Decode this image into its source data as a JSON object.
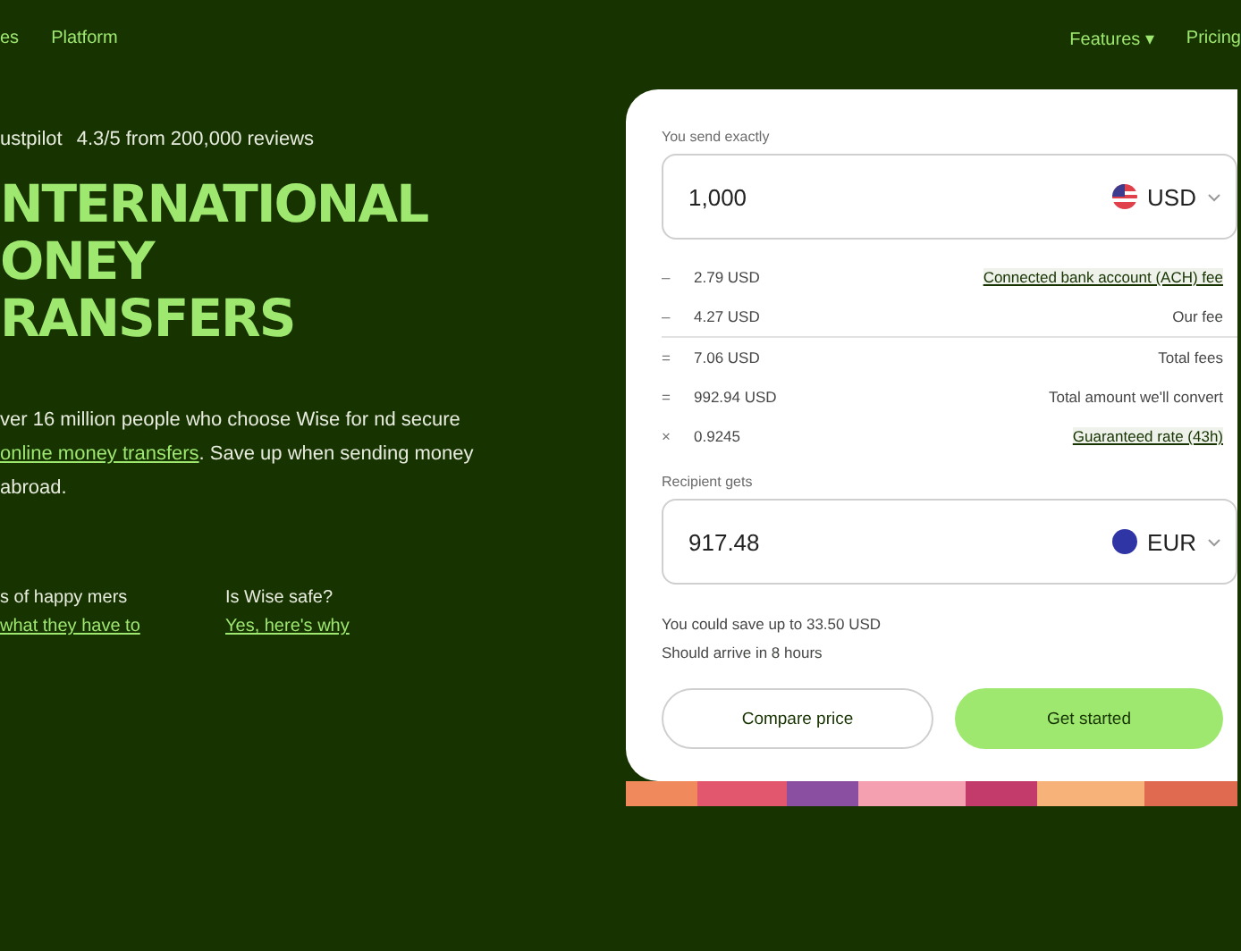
{
  "nav": {
    "left": [
      "es",
      "Platform"
    ],
    "right": [
      {
        "label": "Features",
        "caret": "▾"
      },
      {
        "label": "Pricing"
      }
    ]
  },
  "rating": {
    "brand": "ustpilot",
    "text": "4.3/5 from 200,000 reviews"
  },
  "headline": [
    "NTERNATIONAL",
    "ONEY",
    "RANSFERS"
  ],
  "intro": {
    "before": "ver 16 million people who choose Wise for nd secure ",
    "link": "online money transfers",
    "after": ". Save up when sending money abroad."
  },
  "stats": [
    {
      "text": "s of happy mers",
      "link": "what they have to"
    },
    {
      "text": "Is Wise safe?",
      "link": "Yes, here's why"
    }
  ],
  "calculator": {
    "send_label": "You send exactly",
    "send_amount": "1,000",
    "send_currency": "USD",
    "fees": [
      {
        "sign": "–",
        "amount": "2.79 USD",
        "label": "Connected bank account (ACH) fee",
        "link": true,
        "divider": false
      },
      {
        "sign": "–",
        "amount": "4.27 USD",
        "label": "Our fee",
        "link": false,
        "divider": false
      },
      {
        "sign": "=",
        "amount": "7.06 USD",
        "label": "Total fees",
        "link": false,
        "divider": true
      },
      {
        "sign": "=",
        "amount": "992.94 USD",
        "label": "Total amount we'll convert",
        "link": false,
        "divider": false
      },
      {
        "sign": "×",
        "amount": "0.9245",
        "label": "Guaranteed rate (43h)",
        "link": true,
        "divider": false
      }
    ],
    "receive_label": "Recipient gets",
    "receive_amount": "917.48",
    "receive_currency": "EUR",
    "notes": [
      "You could save up to 33.50 USD",
      "Should arrive in 8 hours"
    ],
    "buttons": [
      {
        "label": "Compare price",
        "kind": "secondary"
      },
      {
        "label": "Get started",
        "kind": "primary"
      }
    ]
  }
}
